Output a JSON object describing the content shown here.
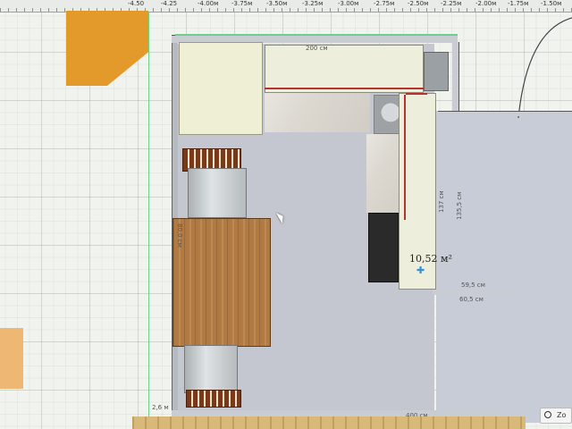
{
  "ruler": {
    "ticks": [
      "-4.50",
      "-4.25",
      "-4.00м",
      "-3.75м",
      "-3.50м",
      "-3.25м",
      "-3.00м",
      "-2.75м",
      "-2.50м",
      "-2.25м",
      "-2.00м",
      "-1.75м",
      "-1.50м"
    ]
  },
  "dimensions": {
    "top_wall": "200 см",
    "left_table": "80,0 см",
    "right_cabinet_a": "137 см",
    "right_cabinet_b": "135,5 см",
    "bottom_small_a": "59,5 см",
    "bottom_small_b": "60,5 см",
    "bottom_wall": "400 см",
    "bottom_left": "2,6 м"
  },
  "room": {
    "area_label": "10,52 м²"
  },
  "toolbar": {
    "zoom_label": "Zo"
  },
  "icons": {
    "move": "move-icon",
    "zoom": "zoom-icon",
    "cursor": "mouse-cursor-icon"
  },
  "colors": {
    "wall_highlight": "#6fcf8a",
    "selection_red": "#b8322c",
    "area_icon": "#2f8ee0"
  }
}
